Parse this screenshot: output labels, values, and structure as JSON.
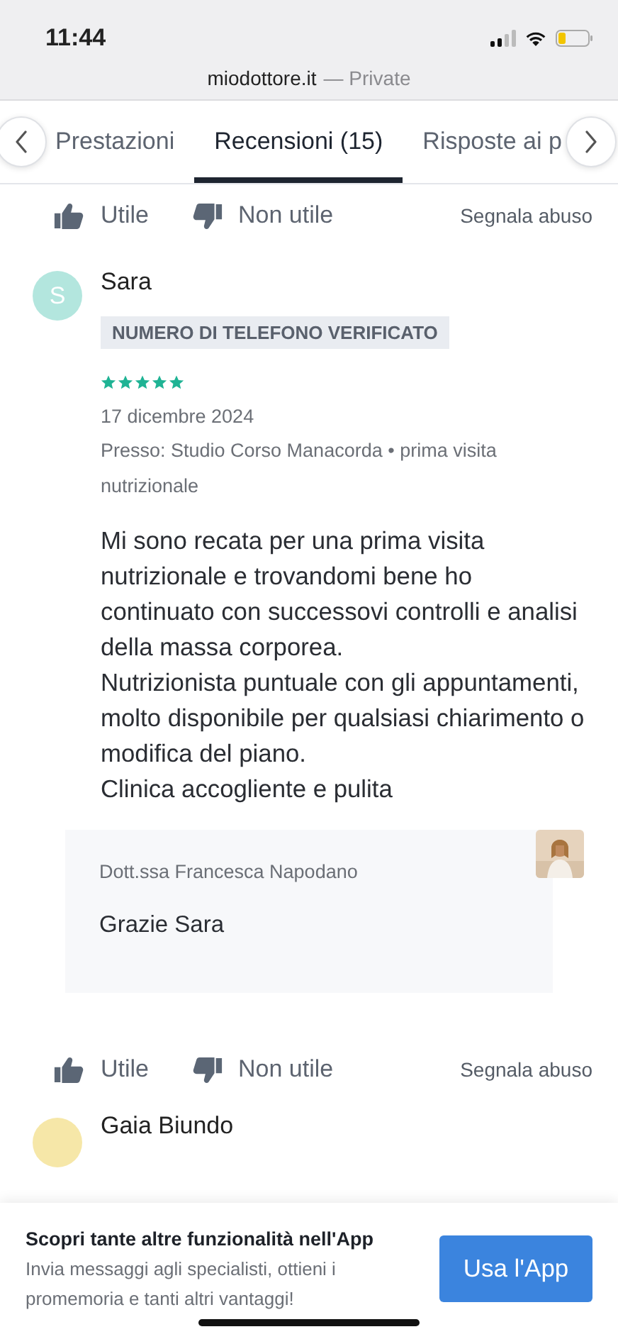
{
  "status_bar": {
    "time": "11:44"
  },
  "address_bar": {
    "domain": "miodottore.it",
    "mode": "— Private"
  },
  "tabs": [
    {
      "label": "Prestazioni",
      "selected": false
    },
    {
      "label": "Recensioni (15)",
      "selected": true
    },
    {
      "label": "Risposte ai p",
      "selected": false
    }
  ],
  "top_actions": {
    "helpful": "Utile",
    "not_helpful": "Non utile",
    "report": "Segnala abuso"
  },
  "review": {
    "avatar_letter": "S",
    "author": "Sara",
    "badge": "NUMERO DI TELEFONO VERIFICATO",
    "stars": 5,
    "date": "17 dicembre 2024",
    "location": "Presso: Studio Corso Manacorda • prima visita nutrizionale",
    "text": "Mi sono recata per una prima visita nutrizionale e trovandomi bene ho continuato con successovi controlli e analisi della massa corporea.\nNutrizionista puntuale con gli appuntamenti, molto disponibile per qualsiasi chiarimento o modifica del piano.\nClinica accogliente e pulita",
    "reply": {
      "author": "Dott.ssa Francesca Napodano",
      "text": "Grazie Sara"
    },
    "actions": {
      "helpful": "Utile",
      "not_helpful": "Non utile",
      "report": "Segnala abuso"
    }
  },
  "next_review": {
    "author": "Gaia Biundo"
  },
  "app_banner": {
    "title": "Scopri tante altre funzionalità nell'App",
    "text": "Invia messaggi agli specialisti, ottieni i promemoria e tanti altri vantaggi!",
    "button": "Usa l'App"
  }
}
